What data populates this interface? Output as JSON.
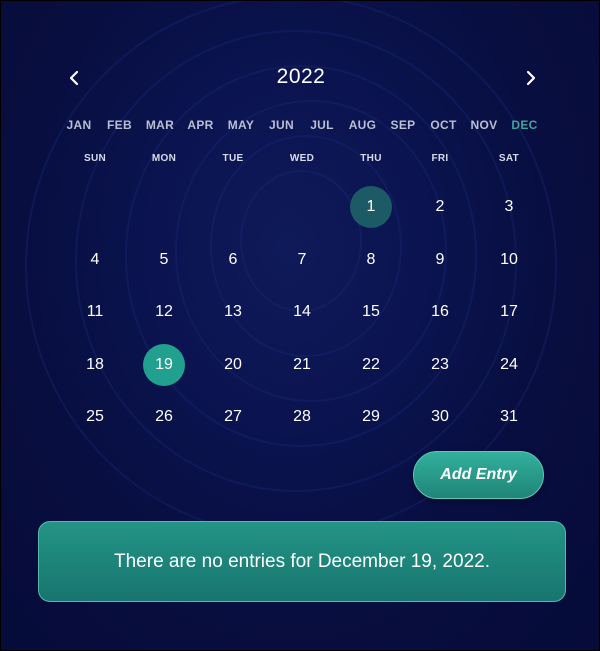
{
  "calendar": {
    "year": "2022",
    "months": [
      "JAN",
      "FEB",
      "MAR",
      "APR",
      "MAY",
      "JUN",
      "JUL",
      "AUG",
      "SEP",
      "OCT",
      "NOV",
      "DEC"
    ],
    "active_month_index": 11,
    "weekdays": [
      "SUN",
      "MON",
      "TUE",
      "WED",
      "THU",
      "FRI",
      "SAT"
    ],
    "first_weekday_index": 4,
    "days_in_month": 31,
    "today_day": 1,
    "selected_day": 19
  },
  "icons": {
    "prev": "chevron-left-icon",
    "next": "chevron-right-icon"
  },
  "actions": {
    "add_entry_label": "Add Entry"
  },
  "entries": {
    "message": "There are no entries for December 19, 2022."
  },
  "colors": {
    "background": "#0b1450",
    "accent": "#3fa59c",
    "selected_day": "#22a08f",
    "today_day": "#1c5a66"
  }
}
